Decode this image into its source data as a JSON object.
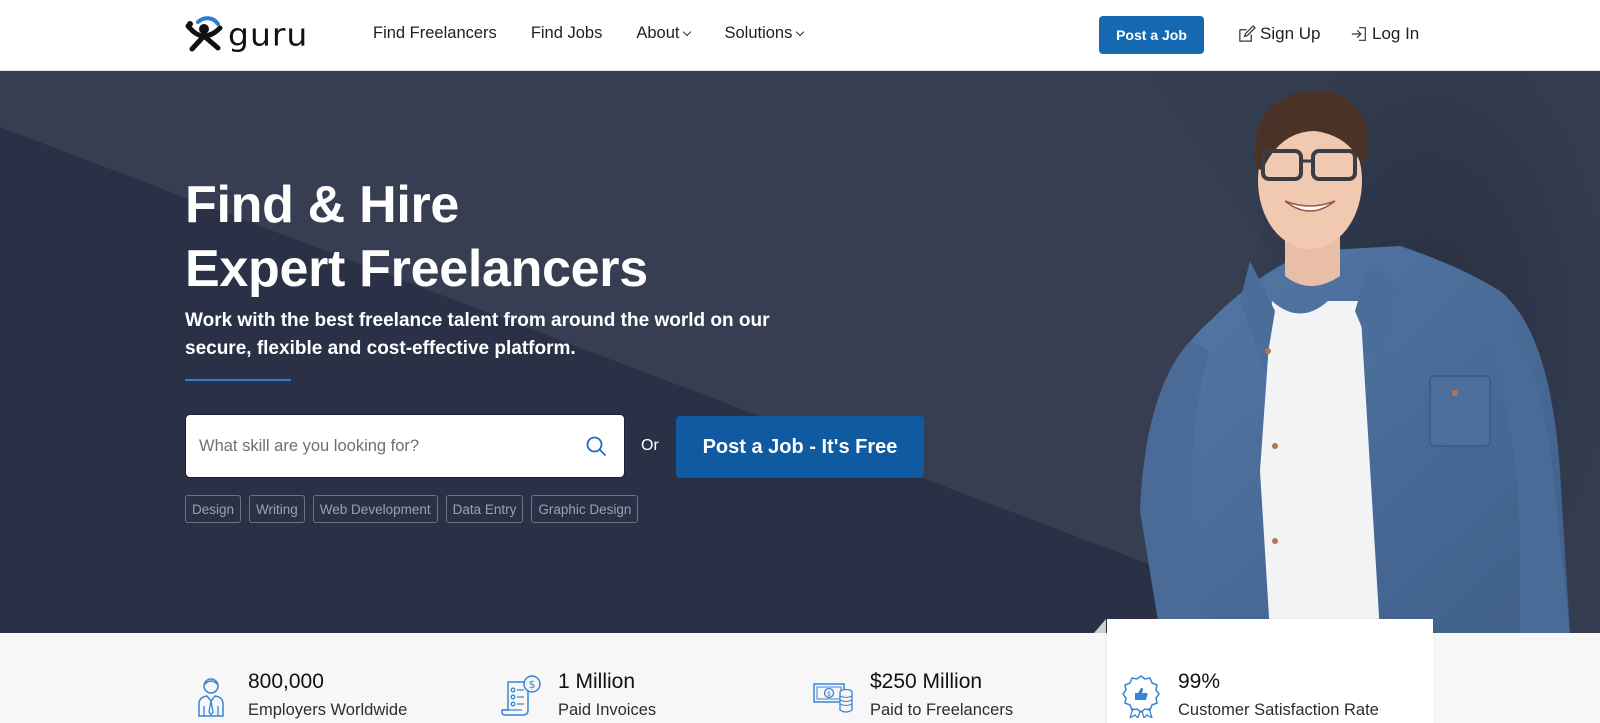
{
  "header": {
    "logo_text": "guru",
    "nav": [
      {
        "label": "Find Freelancers",
        "has_dropdown": false
      },
      {
        "label": "Find Jobs",
        "has_dropdown": false
      },
      {
        "label": "About",
        "has_dropdown": true
      },
      {
        "label": "Solutions",
        "has_dropdown": true
      }
    ],
    "post_job_label": "Post a Job",
    "sign_up_label": "Sign Up",
    "log_in_label": "Log In"
  },
  "hero": {
    "title_line1": "Find & Hire",
    "title_line2": "Expert Freelancers",
    "subtitle": "Work with the best freelance talent from around the world on our secure, flexible and cost-effective platform.",
    "search": {
      "placeholder": "What skill are you looking for?",
      "value": ""
    },
    "or_label": "Or",
    "post_job_cta": "Post a Job - It's Free",
    "tags": [
      "Design",
      "Writing",
      "Web Development",
      "Data Entry",
      "Graphic Design"
    ]
  },
  "stats": [
    {
      "icon": "employer-icon",
      "value": "800,000",
      "label": "Employers Worldwide"
    },
    {
      "icon": "invoice-icon",
      "value": "1 Million",
      "label": "Paid Invoices"
    },
    {
      "icon": "money-icon",
      "value": "$250 Million",
      "label": "Paid to Freelancers"
    },
    {
      "icon": "satisfaction-badge-icon",
      "value": "99%",
      "label": "Customer Satisfaction Rate"
    }
  ],
  "colors": {
    "brand_blue": "#1669b0",
    "cta_blue": "#0f5aa0",
    "hero_dark": "#2a3147",
    "hero_light": "#373e51",
    "icon_blue": "#2f7cd3"
  }
}
